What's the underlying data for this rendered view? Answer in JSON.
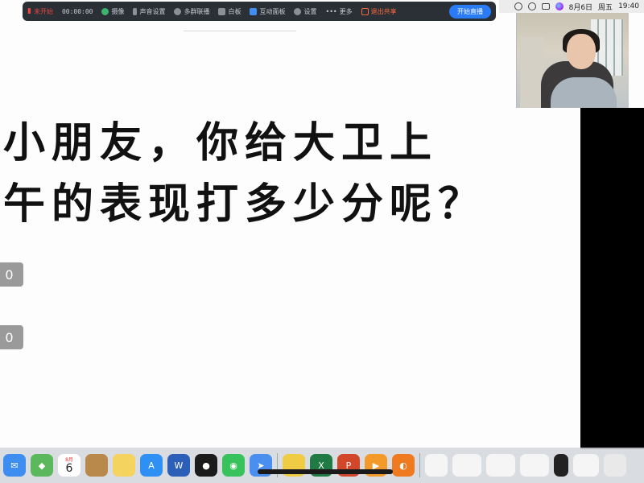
{
  "menubar": {
    "date": "8月6日",
    "weekday": "周五",
    "time": "19:40"
  },
  "toolbar": {
    "recording_status": "未开始",
    "timer": "00:00:00",
    "items": [
      {
        "label": "摄像",
        "icon": "camera-icon"
      },
      {
        "label": "声音设置",
        "icon": "microphone-icon"
      },
      {
        "label": "多群联播",
        "icon": "multi-group-icon"
      },
      {
        "label": "白板",
        "icon": "whiteboard-icon"
      },
      {
        "label": "互动面板",
        "icon": "interactive-panel-icon"
      },
      {
        "label": "设置",
        "icon": "gear-icon"
      },
      {
        "label": "更多",
        "icon": "more-icon"
      }
    ],
    "exit_share": "退出共享",
    "start_live": "开始直播"
  },
  "slide": {
    "line1": "小朋友，你给大卫上",
    "line2": "午的表现打多少分呢？"
  },
  "scores": [
    "0",
    "0"
  ],
  "dock": {
    "apps": [
      {
        "name": "mail",
        "color": "#3d8ef0"
      },
      {
        "name": "maps",
        "color": "#5cb85c"
      },
      {
        "name": "calendar",
        "color": "#ffffff"
      },
      {
        "name": "notes-brown",
        "color": "#b8894a"
      },
      {
        "name": "notes",
        "color": "#f4d35e"
      },
      {
        "name": "app-store",
        "color": "#2e8ff5"
      },
      {
        "name": "word",
        "color": "#2b5fb8"
      },
      {
        "name": "qq",
        "color": "#1b1b1b"
      },
      {
        "name": "wechat",
        "color": "#37c25b"
      },
      {
        "name": "lark",
        "color": "#4a8ef0"
      },
      {
        "name": "notes-yellow",
        "color": "#f0cc45"
      },
      {
        "name": "excel",
        "color": "#1f7a44"
      },
      {
        "name": "powerpoint",
        "color": "#d2472a"
      },
      {
        "name": "music-orange",
        "color": "#f39a2b"
      },
      {
        "name": "tool-orange",
        "color": "#f07a1f"
      }
    ],
    "calendar_month": "8月",
    "calendar_day": "6"
  }
}
